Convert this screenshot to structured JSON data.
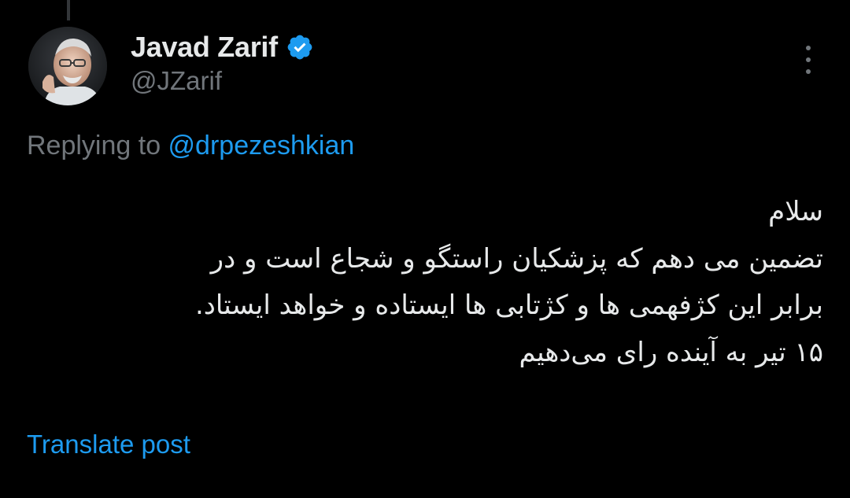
{
  "thread_line": true,
  "author": {
    "display_name": "Javad Zarif",
    "handle": "@JZarif",
    "verified": true,
    "avatar_icon": "user-avatar-photo"
  },
  "menu": {
    "icon": "more-options-icon"
  },
  "reply": {
    "prefix": "Replying to ",
    "target": "@drpezeshkian"
  },
  "post": {
    "lines": [
      "سلام",
      "تضمین می دهم که پزشکیان راستگو و شجاع است و  در",
      "برابر این کژفهمی ها و کژتابی ها ایستاده و خواهد ایستاد.",
      "۱۵ تیر به آینده رای می‌دهیم"
    ]
  },
  "actions": {
    "translate_label": "Translate post"
  },
  "colors": {
    "background": "#000000",
    "primary_text": "#e7e9ea",
    "secondary_text": "#71767b",
    "accent": "#1d9bf0"
  }
}
